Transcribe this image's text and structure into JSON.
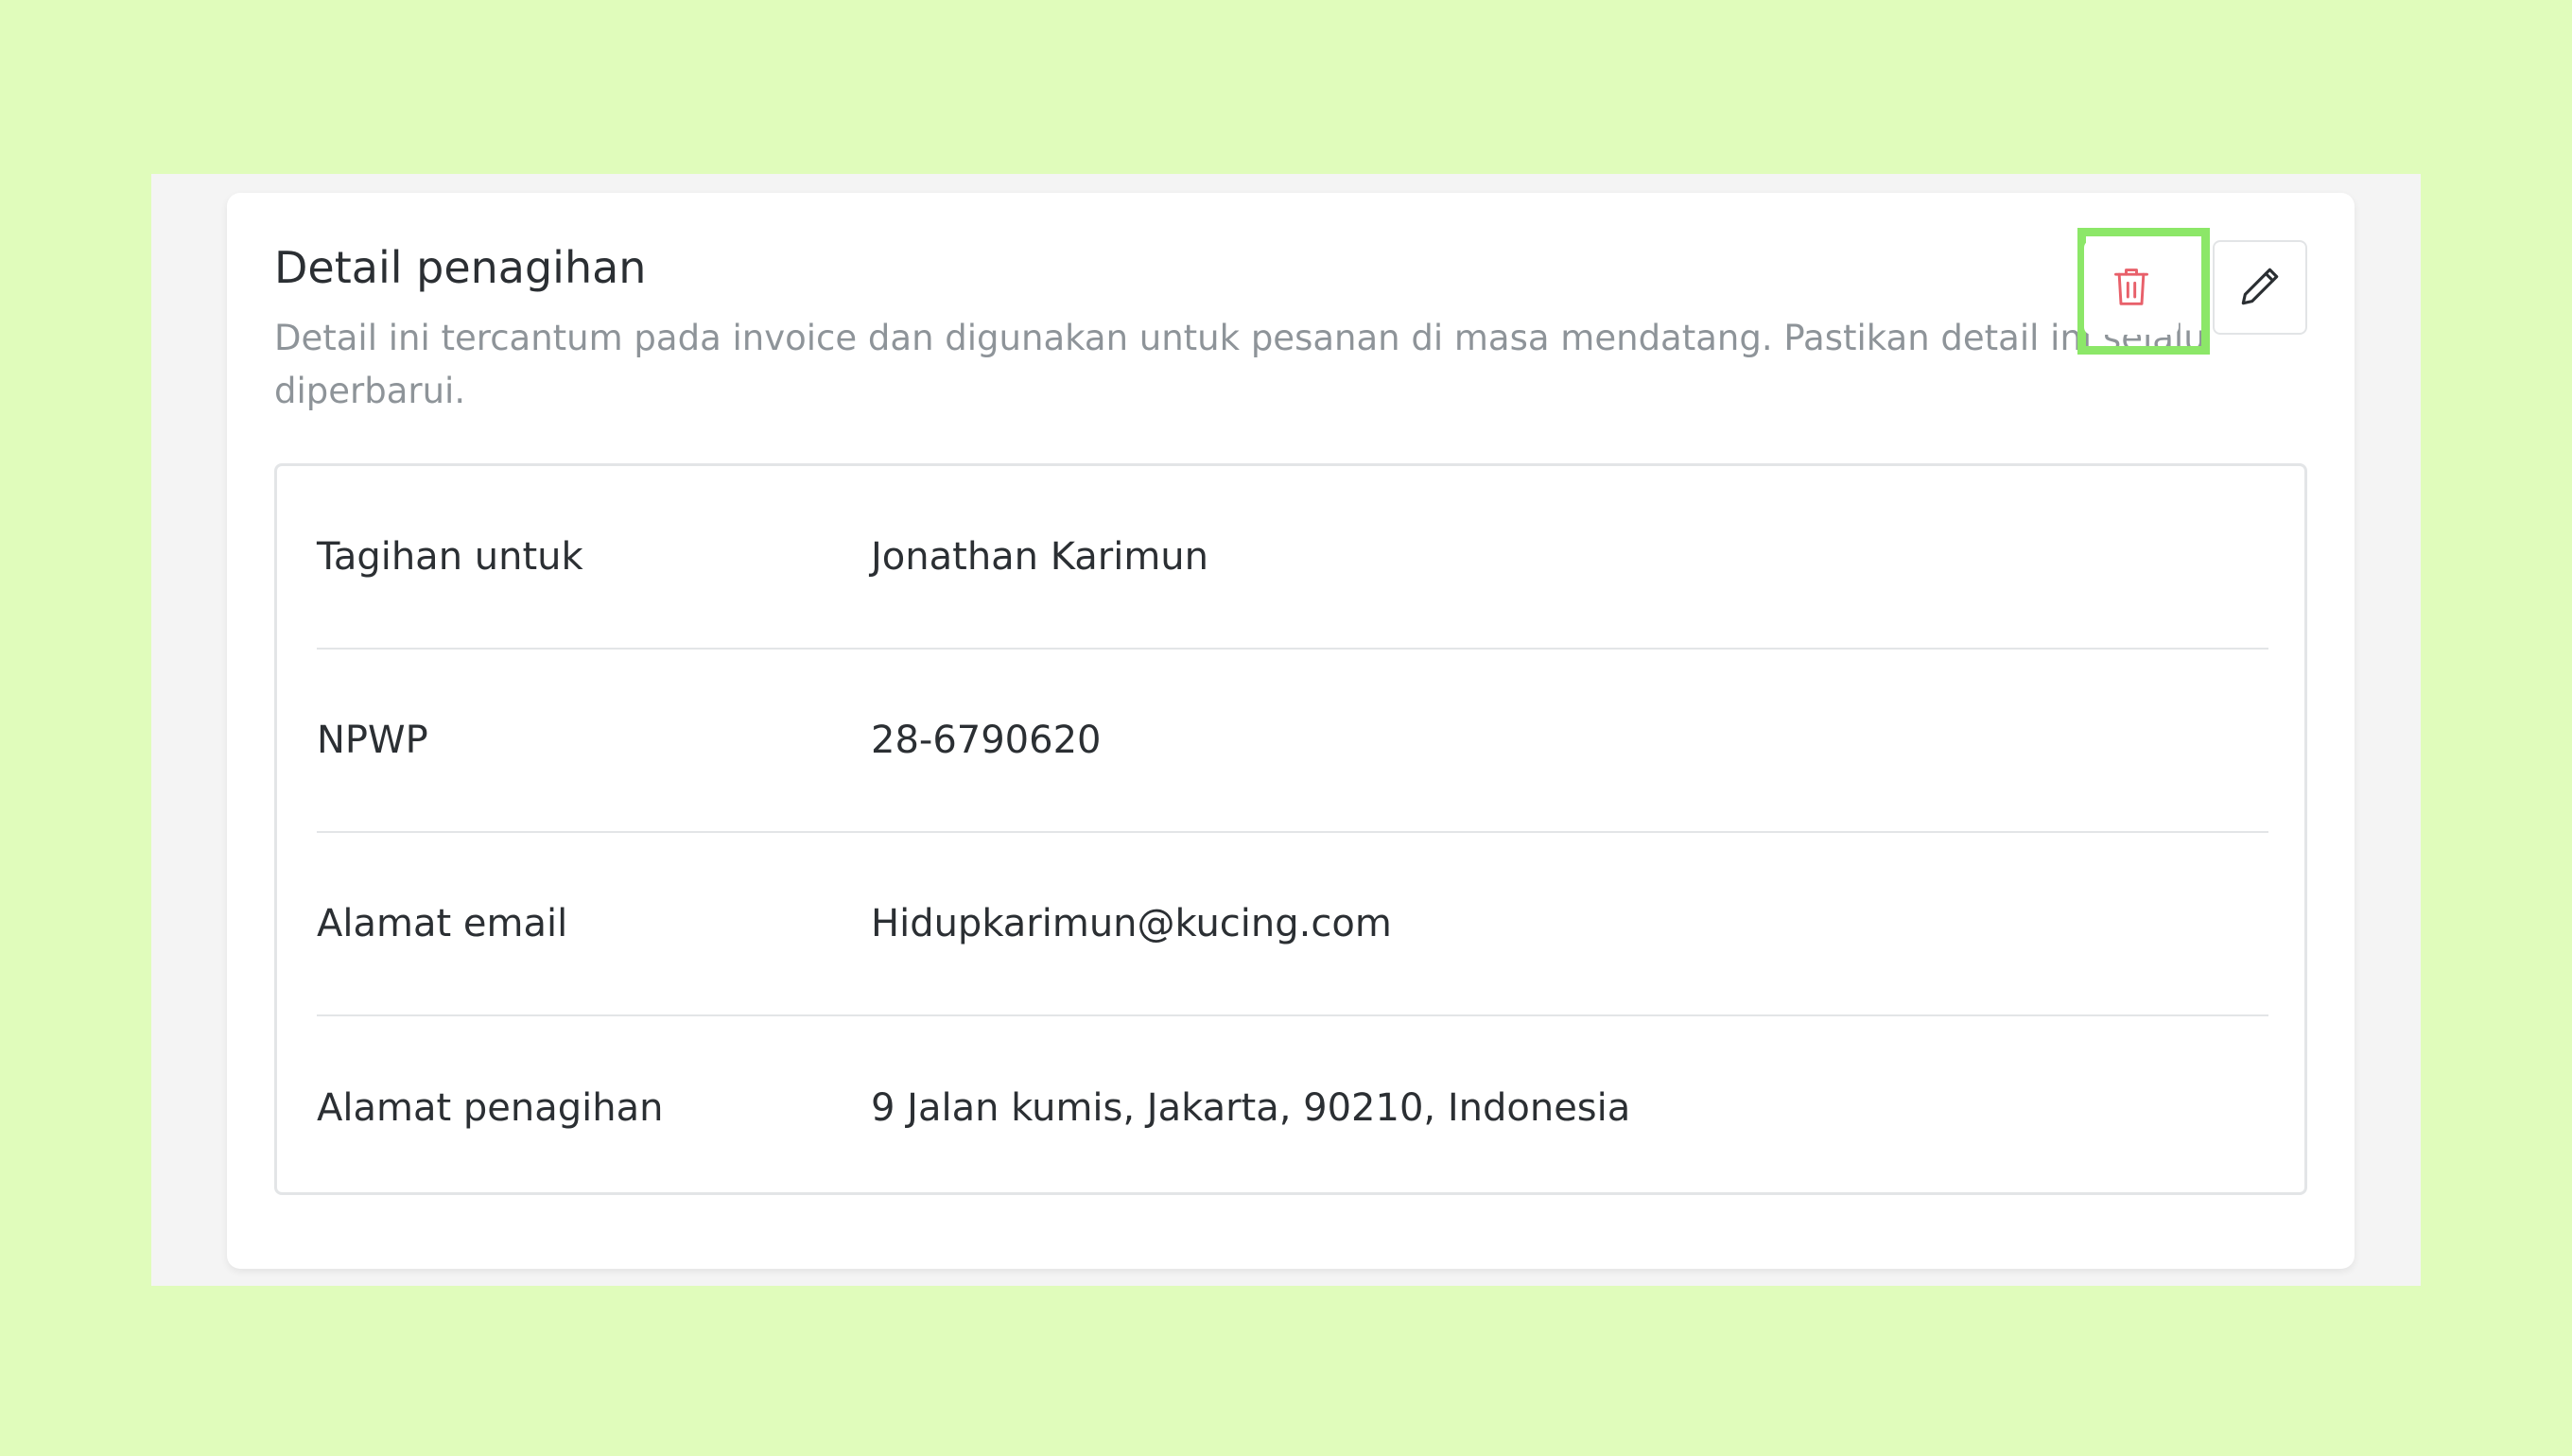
{
  "billing": {
    "title": "Detail penagihan",
    "description": "Detail ini tercantum pada invoice dan digunakan untuk pesanan di masa mendatang. Pastikan detail ini selalu diperbarui.",
    "actions": {
      "delete_icon": "trash-icon",
      "edit_icon": "pencil-icon"
    },
    "rows": [
      {
        "label": "Tagihan untuk",
        "value": "Jonathan Karimun"
      },
      {
        "label": "NPWP",
        "value": "28-6790620"
      },
      {
        "label": "Alamat email",
        "value": "Hidupkarimun@kucing.com"
      },
      {
        "label": "Alamat penagihan",
        "value": "9 Jalan kumis, Jakarta, 90210, Indonesia"
      }
    ]
  },
  "colors": {
    "background": "#e0fcbb",
    "highlight": "#8ce768",
    "delete_icon": "#e8606a",
    "text_primary": "#2b2f33",
    "text_secondary": "#8e9499"
  }
}
